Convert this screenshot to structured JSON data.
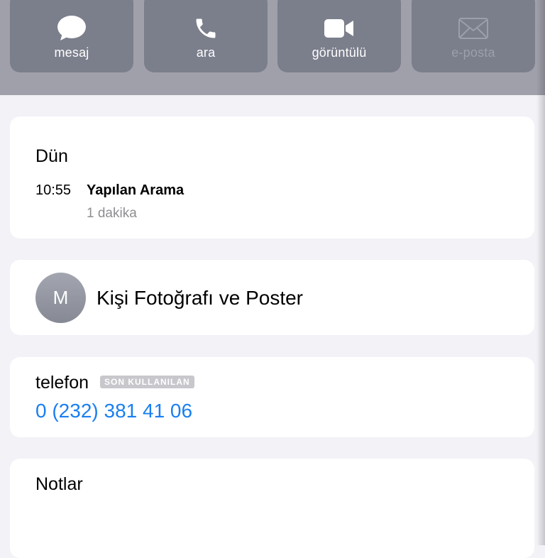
{
  "actions": [
    {
      "label": "mesaj",
      "icon": "message-bubble-icon",
      "enabled": true
    },
    {
      "label": "ara",
      "icon": "phone-icon",
      "enabled": true
    },
    {
      "label": "görüntülü",
      "icon": "video-camera-icon",
      "enabled": true
    },
    {
      "label": "e-posta",
      "icon": "envelope-icon",
      "enabled": false
    }
  ],
  "recents": {
    "day": "Dün",
    "time": "10:55",
    "call_type": "Yapılan Arama",
    "duration": "1 dakika"
  },
  "poster": {
    "avatar_initial": "M",
    "title": "Kişi Fotoğrafı ve Poster"
  },
  "phone": {
    "label": "telefon",
    "badge": "SON KULLANILAN",
    "number": "0 (232) 381 41 06"
  },
  "notes": {
    "label": "Notlar"
  },
  "colors": {
    "link_blue": "#1a7ff0",
    "action_button_bg": "#7b7e8b",
    "top_band_bg": "#a0a0ab",
    "page_bg": "#f2f2f7"
  }
}
